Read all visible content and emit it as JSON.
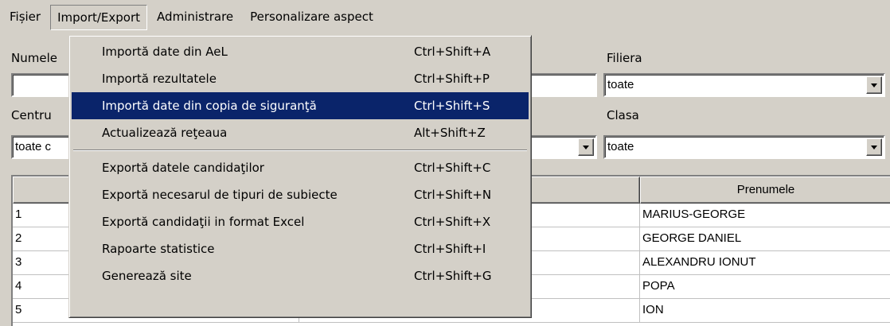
{
  "menubar": {
    "items": [
      "Fișier",
      "Import/Export",
      "Administrare",
      "Personalizare aspect"
    ]
  },
  "filters": {
    "numele_label": "Numele",
    "numele_value": "",
    "filiera_label": "Filiera",
    "filiera_value": "toate",
    "centru_label": "Centru",
    "centru_value": "toate c",
    "clasa_label": "Clasa",
    "clasa_value": "toate"
  },
  "table": {
    "headers": [
      "",
      "",
      "Prenumele"
    ],
    "rows": [
      {
        "nr": "1",
        "prenume": "MARIUS-GEORGE"
      },
      {
        "nr": "2",
        "prenume": "GEORGE DANIEL"
      },
      {
        "nr": "3",
        "prenume": "ALEXANDRU IONUT"
      },
      {
        "nr": "4",
        "prenume": "POPA"
      },
      {
        "nr": "5",
        "prenume": "ION"
      }
    ]
  },
  "dropdown": {
    "items": [
      {
        "label": "Importă date din AeL",
        "shortcut": "Ctrl+Shift+A"
      },
      {
        "label": "Importă rezultatele",
        "shortcut": "Ctrl+Shift+P"
      },
      {
        "label": "Importă date din copia de siguranţă",
        "shortcut": "Ctrl+Shift+S"
      },
      {
        "label": "Actualizează reţeaua",
        "shortcut": "Alt+Shift+Z"
      },
      {
        "label": "Exportă datele candidaţilor",
        "shortcut": "Ctrl+Shift+C"
      },
      {
        "label": "Exportă necesarul de tipuri de subiecte",
        "shortcut": "Ctrl+Shift+N"
      },
      {
        "label": "Exportă candidaţii in format Excel",
        "shortcut": "Ctrl+Shift+X"
      },
      {
        "label": "Rapoarte statistice",
        "shortcut": "Ctrl+Shift+I"
      },
      {
        "label": "Generează site",
        "shortcut": "Ctrl+Shift+G"
      }
    ]
  },
  "colors": {
    "face": "#d4d0c8",
    "highlight": "#0a246a"
  }
}
